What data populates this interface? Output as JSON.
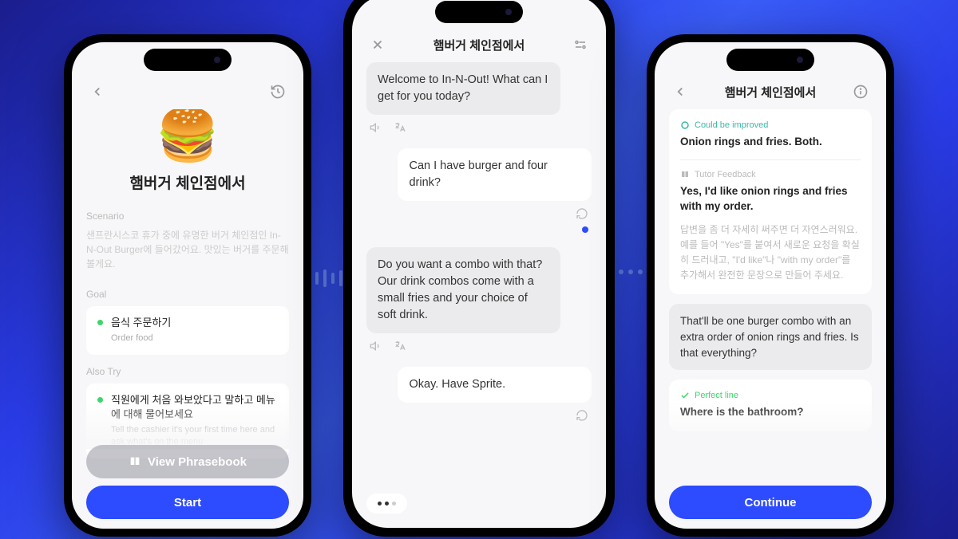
{
  "phone1": {
    "emoji": "🍔",
    "title": "햄버거 체인점에서",
    "scenario_label": "Scenario",
    "scenario_text": "샌프란시스코 휴가 중에 유명한 버거 체인점인 In-N-Out Burger에 들어갔어요. 맛있는 버거를 주문해 볼게요.",
    "goal_label": "Goal",
    "goal_main": "음식 주문하기",
    "goal_sub": "Order food",
    "alsotry_label": "Also Try",
    "alsotry_main": "직원에게 처음 와보았다고 말하고 메뉴에 대해 물어보세요",
    "alsotry_sub": "Tell the cashier it's your first time here and ask what's on the menu",
    "phrasebook_btn": "View Phrasebook",
    "start_btn": "Start"
  },
  "phone2": {
    "title": "햄버거 체인점에서",
    "msg1": "Welcome to In-N-Out! What can I get for you today?",
    "msg2": "Can I have burger and four drink?",
    "msg3": "Do you want a combo with that? Our drink combos come with a small fries and your choice of soft drink.",
    "msg4": "Okay. Have Sprite."
  },
  "phone3": {
    "title": "햄버거 체인점에서",
    "improve_tag": "Could be improved",
    "improve_text": "Onion rings and fries. Both.",
    "tutor_tag": "Tutor Feedback",
    "tutor_text": "Yes, I'd like onion rings and fries with my order.",
    "tutor_korean": "답변을 좀 더 자세히 써주면 더 자연스러워요. 예를 들어 \"Yes\"를 붙여서 새로운 요청을 확실히 드러내고, \"I'd like\"나 \"with my order\"를 추가해서 완전한 문장으로 만들어 주세요.",
    "ai_reply": "That'll be one burger combo with an extra order of onion rings and fries. Is that everything?",
    "perfect_tag": "Perfect line",
    "perfect_text": "Where is the bathroom?",
    "continue_btn": "Continue"
  }
}
